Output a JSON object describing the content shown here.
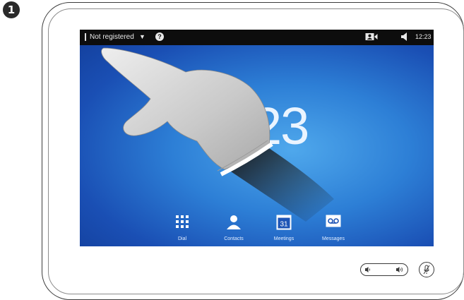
{
  "step": {
    "number": "1"
  },
  "status_bar": {
    "registration": "Not registered",
    "dropdown_glyph": "▼",
    "help_glyph": "?",
    "camera_icon": "camera-self-view-icon",
    "speaker_icon": "speaker-icon",
    "time": "12:23"
  },
  "home": {
    "clock": "23"
  },
  "dock": {
    "items": [
      {
        "label": "Dial",
        "icon": "keypad-icon"
      },
      {
        "label": "Contacts",
        "icon": "person-icon"
      },
      {
        "label": "Meetings",
        "icon": "calendar-icon",
        "badge": "31"
      },
      {
        "label": "Messages",
        "icon": "voicemail-icon"
      }
    ]
  },
  "colors": {
    "status_bar_bg": "#0d0d0d",
    "screen_blue": "#2d7fd6",
    "frame": "#3c3c3c"
  }
}
